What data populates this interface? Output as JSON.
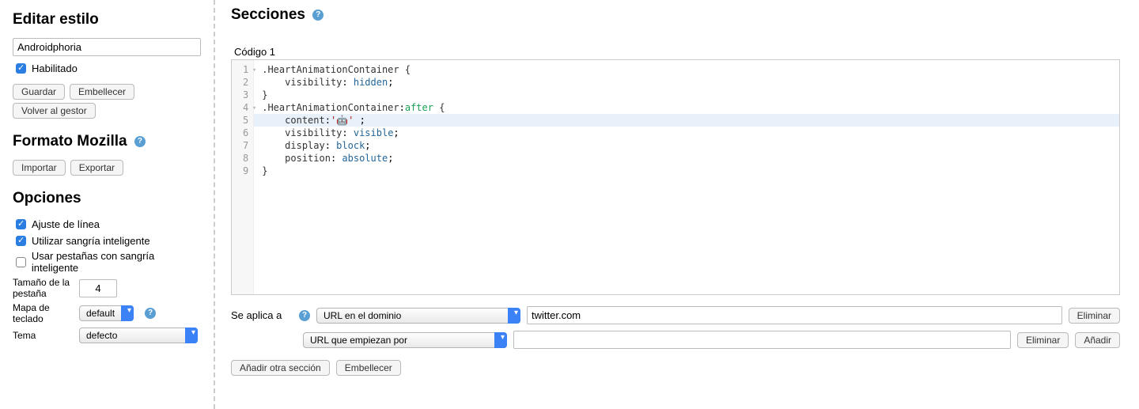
{
  "sidebar": {
    "edit_style_heading": "Editar estilo",
    "name_value": "Androidphoria",
    "enabled_label": "Habilitado",
    "save_btn": "Guardar",
    "beautify_btn": "Embellecer",
    "back_btn": "Volver al gestor",
    "mozilla_heading": "Formato Mozilla",
    "import_btn": "Importar",
    "export_btn": "Exportar",
    "options_heading": "Opciones",
    "opt_linewrap": "Ajuste de línea",
    "opt_smart_indent": "Utilizar sangría inteligente",
    "opt_tabs_smart": "Usar pestañas con sangría inteligente",
    "tab_size_label": "Tamaño de la pestaña",
    "tab_size_value": "4",
    "keymap_label": "Mapa de teclado",
    "keymap_value": "default",
    "theme_label": "Tema",
    "theme_value": "defecto"
  },
  "main": {
    "sections_heading": "Secciones",
    "code_label": "Código 1",
    "code_lines": [
      ".HeartAnimationContainer {",
      "    visibility: hidden;",
      "}",
      ".HeartAnimationContainer:after {",
      "    content:'🤖' ;",
      "    visibility: visible;",
      "    display: block;",
      "    position: absolute;",
      "}"
    ],
    "applies_to_label": "Se aplica a",
    "rule1_type": "URL en el dominio",
    "rule1_value": "twitter.com",
    "rule2_type": "URL que empiezan por",
    "rule2_value": "",
    "delete_btn": "Eliminar",
    "add_btn": "Añadir",
    "add_section_btn": "Añadir otra sección",
    "beautify_btn": "Embellecer"
  }
}
